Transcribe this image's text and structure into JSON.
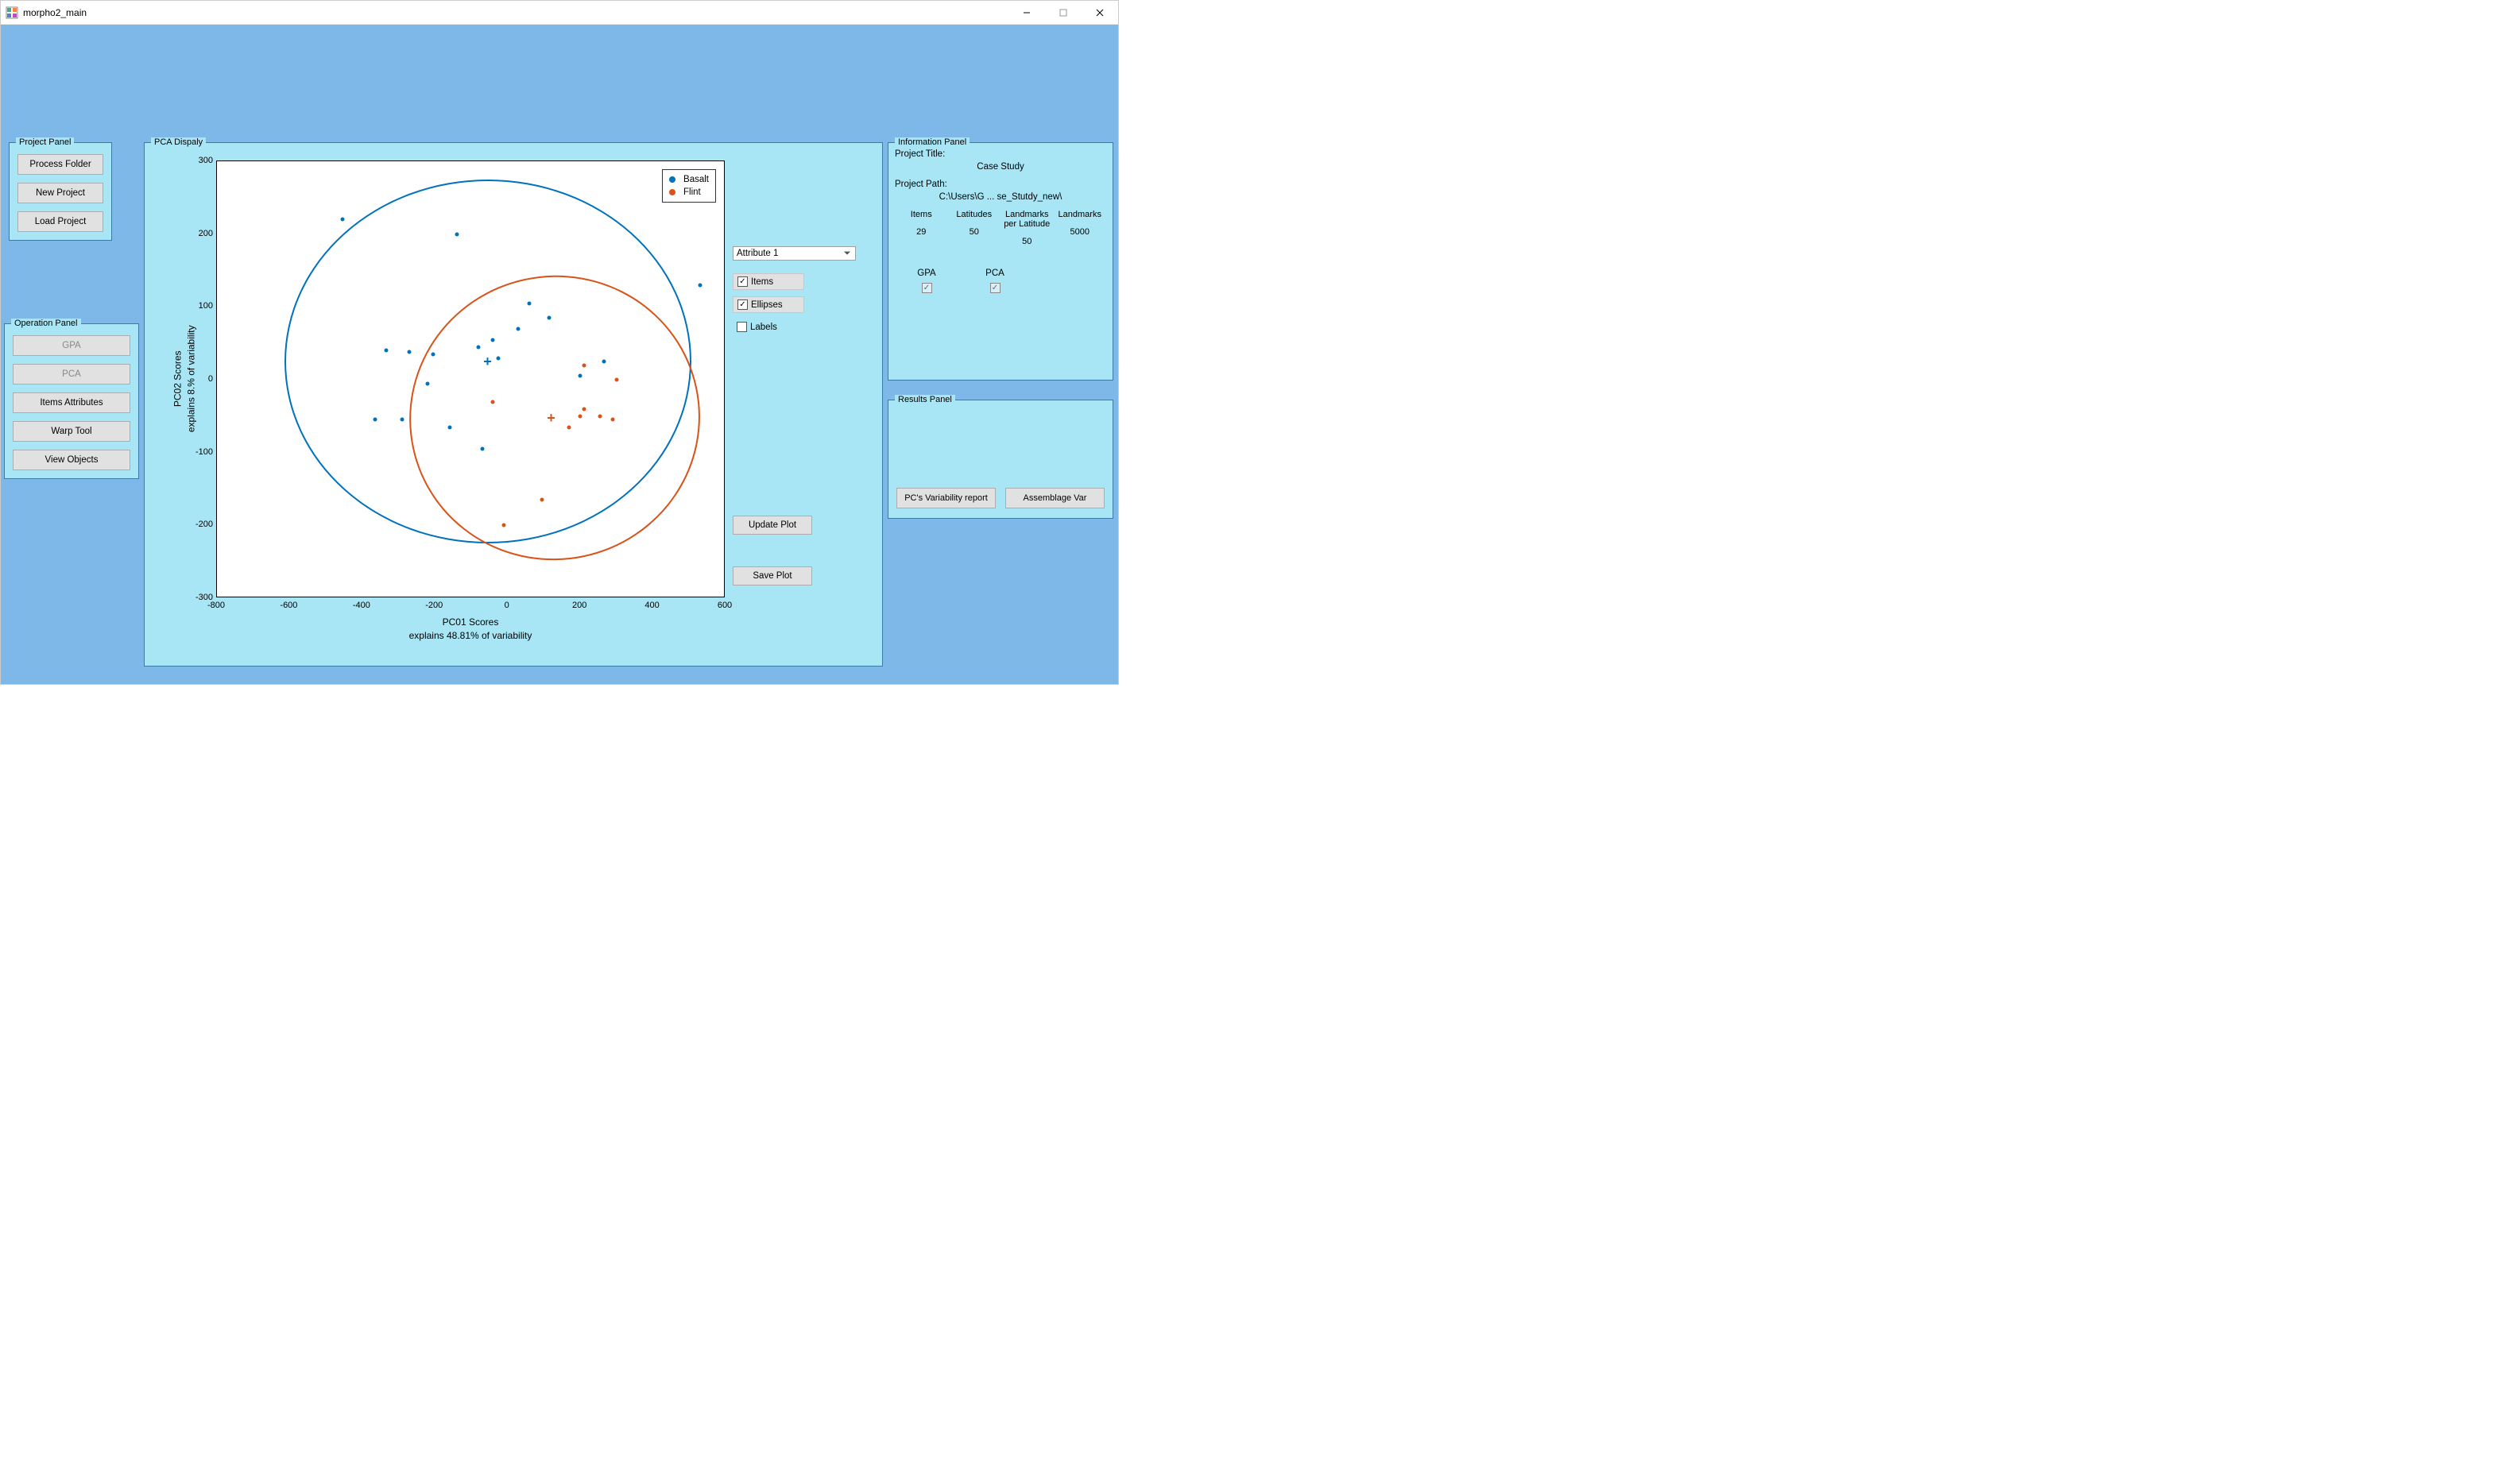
{
  "window": {
    "title": "morpho2_main"
  },
  "project_panel": {
    "title": "Project Panel",
    "process_folder": "Process Folder",
    "new_project": "New Project",
    "load_project": "Load Project"
  },
  "operation_panel": {
    "title": "Operation Panel",
    "gpa": "GPA",
    "pca": "PCA",
    "items_attributes": "Items Attributes",
    "warp_tool": "Warp Tool",
    "view_objects": "View Objects"
  },
  "pca_panel": {
    "title": "PCA Dispaly",
    "attribute_select": "Attribute 1",
    "chk_items": "Items",
    "chk_ellipses": "Ellipses",
    "chk_labels": "Labels",
    "update_plot": "Update Plot",
    "save_plot": "Save Plot",
    "legend": {
      "basalt": "Basalt",
      "flint": "Flint"
    },
    "xlabel_line1": "PC01 Scores",
    "xlabel_line2": "explains 48.81% of variability",
    "ylabel_line1": "PC02 Scores",
    "ylabel_line2": "explains 8.% of variability",
    "xticks": [
      "-800",
      "-600",
      "-400",
      "-200",
      "0",
      "200",
      "400",
      "600"
    ],
    "yticks": [
      "-300",
      "-200",
      "-100",
      "0",
      "100",
      "200",
      "300"
    ]
  },
  "info_panel": {
    "title": "Information Panel",
    "project_title_label": "Project Title:",
    "project_title_value": "Case Study",
    "project_path_label": "Project Path:",
    "project_path_value": "C:\\Users\\G ... se_Stutdy_new\\",
    "cols": {
      "items": "Items",
      "latitudes": "Latitudes",
      "lpl": "Landmarks per Latitude",
      "landmarks": "Landmarks"
    },
    "vals": {
      "items": "29",
      "latitudes": "50",
      "lpl": "50",
      "landmarks": "5000"
    },
    "gpa": "GPA",
    "pca": "PCA"
  },
  "results_panel": {
    "title": "Results Panel",
    "pcs_report": "PC's Variability report",
    "assemblage_var": "Assemblage Var"
  },
  "chart_data": {
    "type": "scatter",
    "title": "",
    "xlabel": "PC01 Scores — explains 48.81% of variability",
    "ylabel": "PC02 Scores — explains 8.% of variability",
    "xlim": [
      -800,
      600
    ],
    "ylim": [
      -300,
      300
    ],
    "xticks": [
      -800,
      -600,
      -400,
      -200,
      0,
      200,
      400,
      600
    ],
    "yticks": [
      -300,
      -200,
      -100,
      0,
      100,
      200,
      300
    ],
    "series": [
      {
        "name": "Basalt",
        "color": "#0072bd",
        "centroid": {
          "x": -55,
          "y": 25
        },
        "ellipse": {
          "cx": -55,
          "cy": 25,
          "rx": 560,
          "ry": 250,
          "angle": 0
        },
        "points": [
          {
            "x": -455,
            "y": 220
          },
          {
            "x": -140,
            "y": 200
          },
          {
            "x": -335,
            "y": 40
          },
          {
            "x": -270,
            "y": 38
          },
          {
            "x": -205,
            "y": 35
          },
          {
            "x": -80,
            "y": 45
          },
          {
            "x": -40,
            "y": 55
          },
          {
            "x": 30,
            "y": 70
          },
          {
            "x": 60,
            "y": 105
          },
          {
            "x": 115,
            "y": 85
          },
          {
            "x": 200,
            "y": 5
          },
          {
            "x": 265,
            "y": 25
          },
          {
            "x": 530,
            "y": 130
          },
          {
            "x": -25,
            "y": 30
          },
          {
            "x": -220,
            "y": -5
          },
          {
            "x": -365,
            "y": -55
          },
          {
            "x": -290,
            "y": -55
          },
          {
            "x": -160,
            "y": -65
          },
          {
            "x": -70,
            "y": -95
          }
        ]
      },
      {
        "name": "Flint",
        "color": "#d95319",
        "centroid": {
          "x": 120,
          "y": -52
        },
        "ellipse": {
          "cx": 130,
          "cy": -52,
          "rx": 400,
          "ry": 195,
          "angle": -12
        },
        "points": [
          {
            "x": 210,
            "y": 20
          },
          {
            "x": 300,
            "y": 0
          },
          {
            "x": 210,
            "y": -40
          },
          {
            "x": 255,
            "y": -50
          },
          {
            "x": 290,
            "y": -55
          },
          {
            "x": 170,
            "y": -65
          },
          {
            "x": -40,
            "y": -30
          },
          {
            "x": 95,
            "y": -165
          },
          {
            "x": -10,
            "y": -200
          },
          {
            "x": 200,
            "y": -50
          }
        ]
      }
    ]
  }
}
